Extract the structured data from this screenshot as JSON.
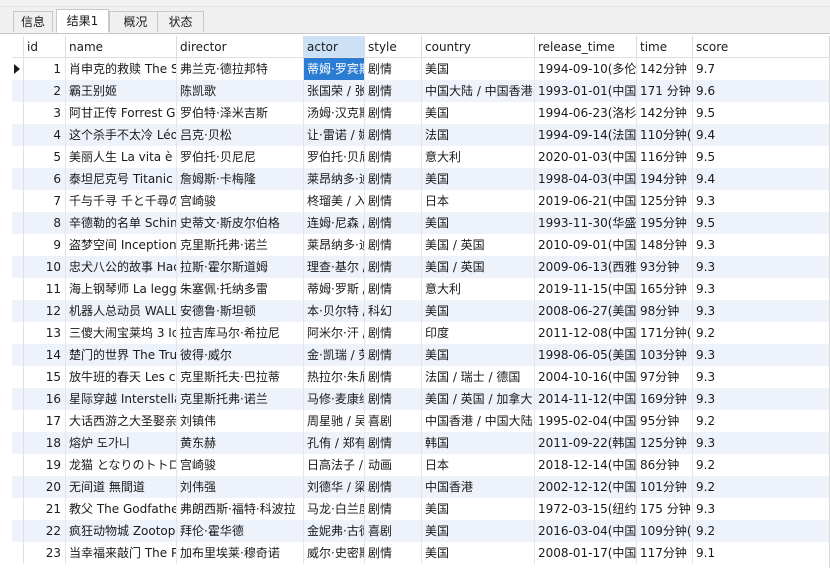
{
  "tabs": [
    {
      "label": "信息",
      "active": false
    },
    {
      "label": "结果1",
      "active": true
    },
    {
      "label": "概况",
      "active": false
    },
    {
      "label": "状态",
      "active": false
    }
  ],
  "columns": [
    "id",
    "name",
    "director",
    "actor",
    "style",
    "country",
    "release_time",
    "time",
    "score"
  ],
  "selected_column": "actor",
  "selected_row": 1,
  "rows": [
    [
      "1",
      "肖申克的救赎 The S",
      "弗兰克·德拉邦特",
      "蒂姆·罗宾斯",
      "剧情",
      "美国",
      "1994-09-10(多伦多",
      "142分钟",
      "9.7"
    ],
    [
      "2",
      "霸王别姬",
      "陈凯歌",
      "张国荣 / 张",
      "剧情",
      "中国大陆 / 中国香港",
      "1993-01-01(中国香",
      "171 分钟",
      "9.6"
    ],
    [
      "3",
      "阿甘正传 Forrest Gu",
      "罗伯特·泽米吉斯",
      "汤姆·汉克斯",
      "剧情",
      "美国",
      "1994-06-23(洛杉矶",
      "142分钟",
      "9.5"
    ],
    [
      "4",
      "这个杀手不太冷 Léo",
      "吕克·贝松",
      "让·雷诺 / 娜",
      "剧情",
      "法国",
      "1994-09-14(法国)",
      "110分钟(",
      "9.4"
    ],
    [
      "5",
      "美丽人生 La vita è b",
      "罗伯托·贝尼尼",
      "罗伯托·贝尼",
      "剧情",
      "意大利",
      "2020-01-03(中国大",
      "116分钟",
      "9.5"
    ],
    [
      "6",
      "泰坦尼克号 Titanic",
      "詹姆斯·卡梅隆",
      "莱昂纳多·迪",
      "剧情",
      "美国",
      "1998-04-03(中国大",
      "194分钟",
      "9.4"
    ],
    [
      "7",
      "千与千寻 千と千尋の",
      "宫崎骏",
      "柊瑠美 / 入",
      "剧情",
      "日本",
      "2019-06-21(中国大",
      "125分钟",
      "9.3"
    ],
    [
      "8",
      "辛德勒的名单 Schin",
      "史蒂文·斯皮尔伯格",
      "连姆·尼森 /",
      "剧情",
      "美国",
      "1993-11-30(华盛顿",
      "195分钟",
      "9.5"
    ],
    [
      "9",
      "盗梦空间 Inception",
      "克里斯托弗·诺兰",
      "莱昂纳多·迪",
      "剧情",
      "美国 / 英国",
      "2010-09-01(中国大",
      "148分钟",
      "9.3"
    ],
    [
      "10",
      "忠犬八公的故事 Hac",
      "拉斯·霍尔斯道姆",
      "理查·基尔 /",
      "剧情",
      "美国 / 英国",
      "2009-06-13(西雅图",
      "93分钟",
      "9.3"
    ],
    [
      "11",
      "海上钢琴师 La legg",
      "朱塞佩·托纳多雷",
      "蒂姆·罗斯 /",
      "剧情",
      "意大利",
      "2019-11-15(中国大",
      "165分钟",
      "9.3"
    ],
    [
      "12",
      "机器人总动员 WALL",
      "安德鲁·斯坦顿",
      "本·贝尔特 /",
      "科幻",
      "美国",
      "2008-06-27(美国)",
      "98分钟",
      "9.3"
    ],
    [
      "13",
      "三傻大闹宝莱坞 3 Id",
      "拉吉库马尔·希拉尼",
      "阿米尔·汗 /",
      "剧情",
      "印度",
      "2011-12-08(中国大",
      "171分钟(",
      "9.2"
    ],
    [
      "14",
      "楚门的世界 The Tru",
      "彼得·威尔",
      "金·凯瑞 / 劳",
      "剧情",
      "美国",
      "1998-06-05(美国)",
      "103分钟",
      "9.3"
    ],
    [
      "15",
      "放牛班的春天 Les cl",
      "克里斯托夫·巴拉蒂",
      "热拉尔·朱尼",
      "剧情",
      "法国 / 瑞士 / 德国",
      "2004-10-16(中国大",
      "97分钟",
      "9.3"
    ],
    [
      "16",
      "星际穿越 Interstella",
      "克里斯托弗·诺兰",
      "马修·麦康纳",
      "剧情",
      "美国 / 英国 / 加拿大",
      "2014-11-12(中国大",
      "169分钟",
      "9.3"
    ],
    [
      "17",
      "大话西游之大圣娶亲",
      "刘镇伟",
      "周星驰 / 吴",
      "喜剧",
      "中国香港 / 中国大陆",
      "1995-02-04(中国香",
      "95分钟",
      "9.2"
    ],
    [
      "18",
      "熔炉 도가니",
      "黄东赫",
      "孔侑 / 郑有",
      "剧情",
      "韩国",
      "2011-09-22(韩国)",
      "125分钟",
      "9.3"
    ],
    [
      "19",
      "龙猫 となりのトトロ",
      "宫崎骏",
      "日高法子 /",
      "动画",
      "日本",
      "2018-12-14(中国大",
      "86分钟",
      "9.2"
    ],
    [
      "20",
      "无间道 無間道",
      "刘伟强",
      "刘德华 / 梁",
      "剧情",
      "中国香港",
      "2002-12-12(中国香",
      "101分钟",
      "9.2"
    ],
    [
      "21",
      "教父 The Godfathe",
      "弗朗西斯·福特·科波拉",
      "马龙·白兰度",
      "剧情",
      "美国",
      "1972-03-15(纽约首",
      "175 分钟",
      "9.3"
    ],
    [
      "22",
      "疯狂动物城 Zootop",
      "拜伦·霍华德",
      "金妮弗·古德",
      "喜剧",
      "美国",
      "2016-03-04(中国大",
      "109分钟(",
      "9.2"
    ],
    [
      "23",
      "当幸福来敲门 The P",
      "加布里埃莱·穆奇诺",
      "威尔·史密斯",
      "剧情",
      "美国",
      "2008-01-17(中国大",
      "117分钟",
      "9.1"
    ]
  ]
}
